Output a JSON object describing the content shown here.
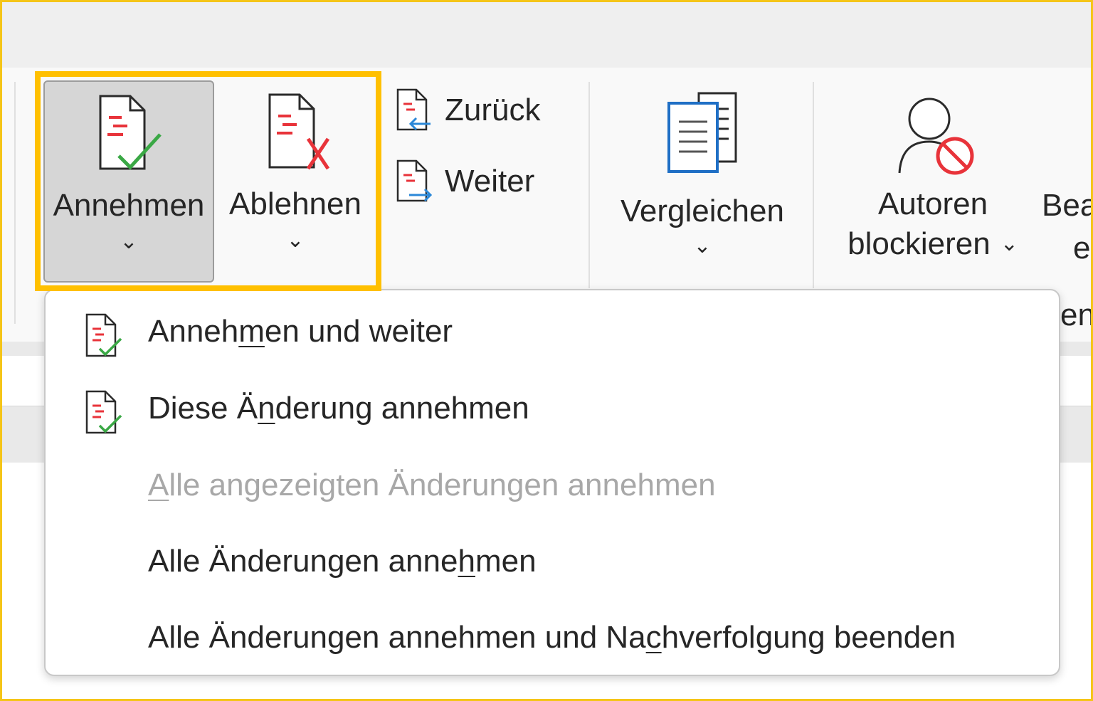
{
  "ribbon": {
    "accept": {
      "label": "Annehmen",
      "chevron": "⌄"
    },
    "reject": {
      "label": "Ablehnen",
      "chevron": "⌄"
    },
    "previous": {
      "label": "Zurück"
    },
    "next": {
      "label": "Weiter"
    },
    "compare": {
      "label": "Vergleichen",
      "chevron": "⌄"
    },
    "block_authors": {
      "label_line1": "Autoren",
      "label_line2": "blockieren",
      "chevron": "⌄"
    },
    "cut_label_top": "Bea",
    "cut_label_bottom": "e",
    "cut_group_fragment": "en"
  },
  "accept_menu": {
    "items": [
      {
        "pre": "Anneh",
        "accel": "m",
        "post": "en und weiter",
        "icon": "accept-change-icon",
        "enabled": true
      },
      {
        "pre": "Diese Ä",
        "accel": "n",
        "post": "derung annehmen",
        "icon": "accept-change-icon",
        "enabled": true
      },
      {
        "pre": "",
        "accel": "A",
        "post": "lle angezeigten Änderungen annehmen",
        "icon": "",
        "enabled": false
      },
      {
        "pre": "Alle Änderungen anne",
        "accel": "h",
        "post": "men",
        "icon": "",
        "enabled": true
      },
      {
        "pre": "Alle Änderungen annehmen und Na",
        "accel": "c",
        "post": "hverfolgung beenden",
        "icon": "",
        "enabled": true
      }
    ]
  },
  "colors": {
    "highlight": "#ffc000",
    "check_green": "#3aa845",
    "cross_red": "#e8333a",
    "arrow_blue": "#2b88d8",
    "doc_blue": "#1f6fc5"
  }
}
